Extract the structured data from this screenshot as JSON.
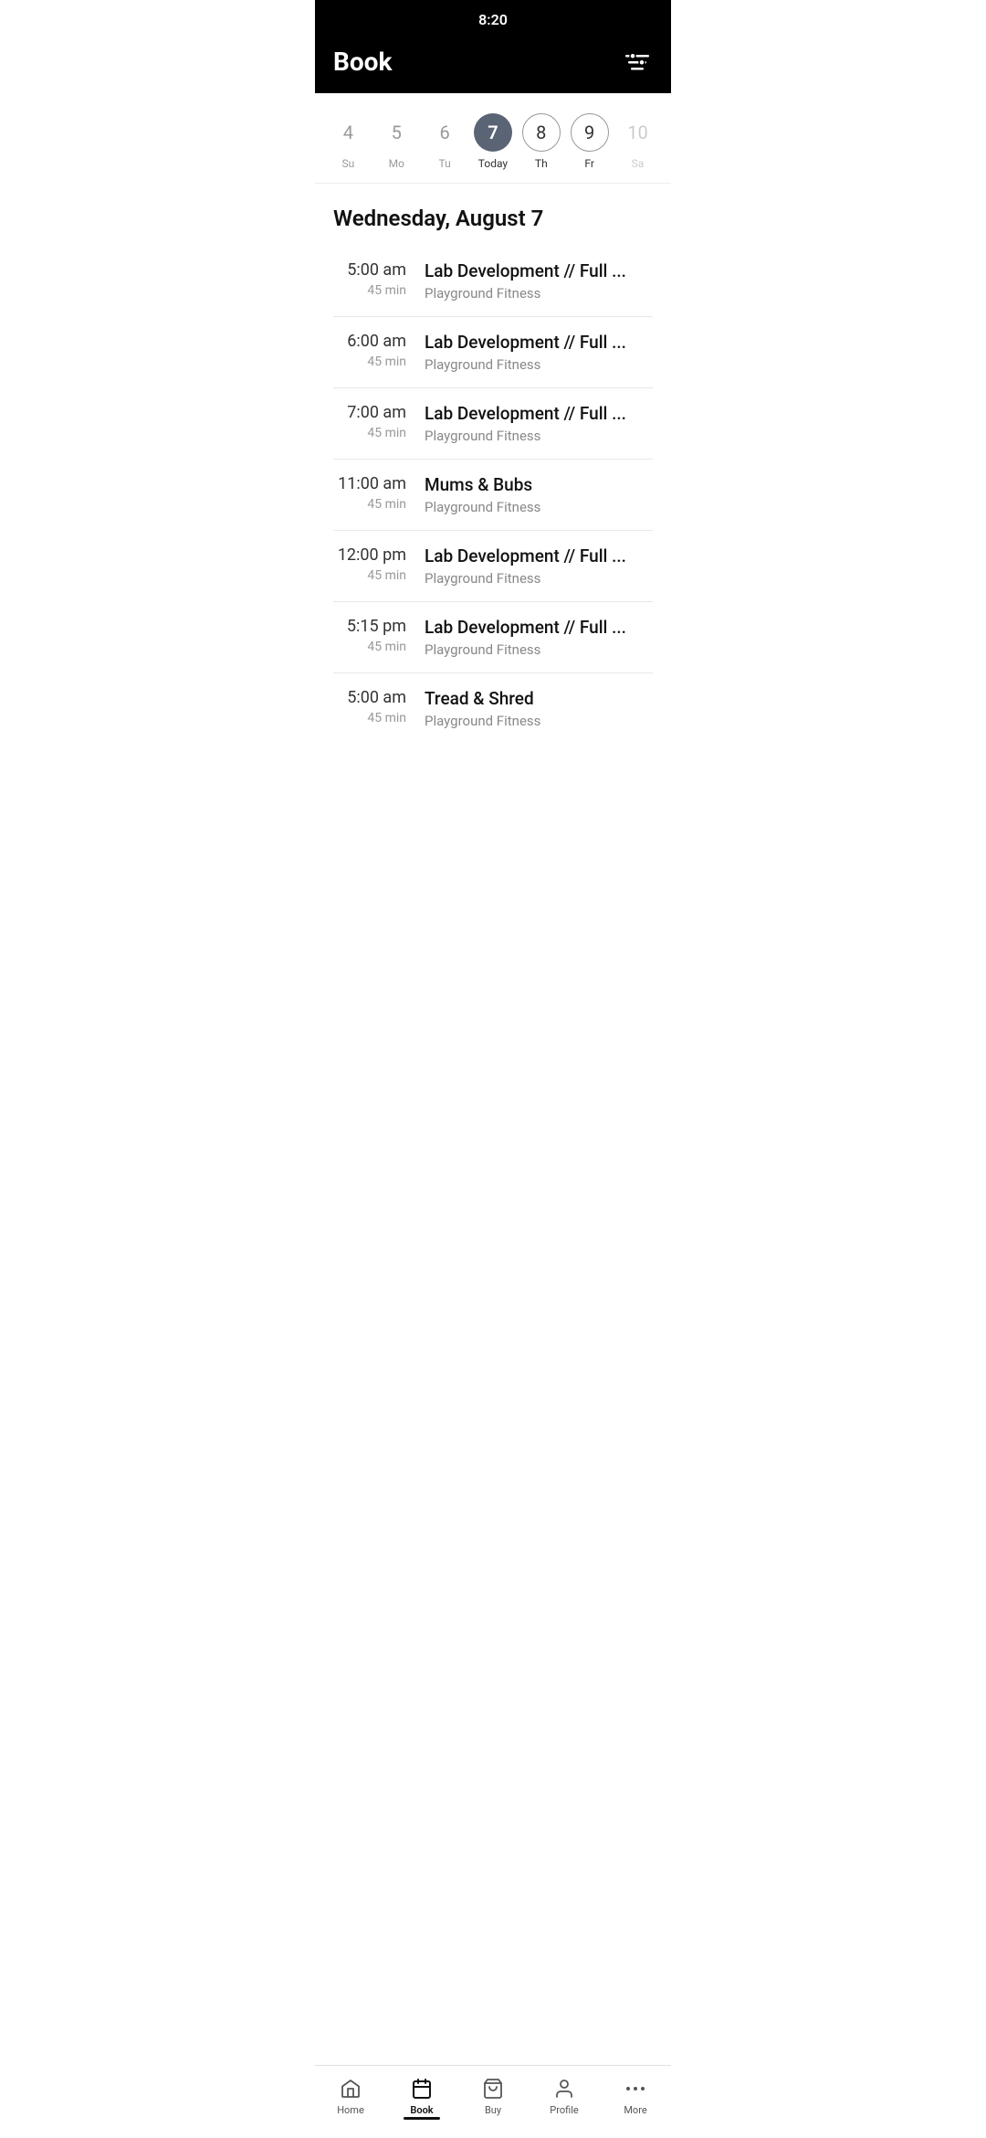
{
  "statusBar": {
    "time": "8:20"
  },
  "header": {
    "title": "Book",
    "filterIcon": "filter-icon"
  },
  "calendar": {
    "days": [
      {
        "number": "4",
        "label": "Su",
        "state": "inactive"
      },
      {
        "number": "5",
        "label": "Mo",
        "state": "inactive"
      },
      {
        "number": "6",
        "label": "Tu",
        "state": "inactive"
      },
      {
        "number": "7",
        "label": "Today",
        "state": "active"
      },
      {
        "number": "8",
        "label": "Th",
        "state": "outlined"
      },
      {
        "number": "9",
        "label": "Fr",
        "state": "outlined"
      },
      {
        "number": "10",
        "label": "Sa",
        "state": "light"
      }
    ]
  },
  "dateHeading": "Wednesday, August 7",
  "schedule": [
    {
      "time": "5:00 am",
      "duration": "45 min",
      "className": "Lab Development // Full ...",
      "location": "Playground Fitness"
    },
    {
      "time": "6:00 am",
      "duration": "45 min",
      "className": "Lab Development // Full ...",
      "location": "Playground Fitness"
    },
    {
      "time": "7:00 am",
      "duration": "45 min",
      "className": "Lab Development // Full ...",
      "location": "Playground Fitness"
    },
    {
      "time": "11:00 am",
      "duration": "45 min",
      "className": "Mums & Bubs",
      "location": "Playground Fitness"
    },
    {
      "time": "12:00 pm",
      "duration": "45 min",
      "className": "Lab Development // Full ...",
      "location": "Playground Fitness"
    },
    {
      "time": "5:15 pm",
      "duration": "45 min",
      "className": "Lab Development // Full ...",
      "location": "Playground Fitness"
    },
    {
      "time": "5:00 am",
      "duration": "45 min",
      "className": "Tread & Shred",
      "location": "Playground Fitness"
    }
  ],
  "bottomNav": {
    "items": [
      {
        "label": "Home",
        "icon": "home-icon",
        "active": false
      },
      {
        "label": "Book",
        "icon": "book-icon",
        "active": true
      },
      {
        "label": "Buy",
        "icon": "buy-icon",
        "active": false
      },
      {
        "label": "Profile",
        "icon": "profile-icon",
        "active": false
      },
      {
        "label": "More",
        "icon": "more-icon",
        "active": false
      }
    ]
  }
}
